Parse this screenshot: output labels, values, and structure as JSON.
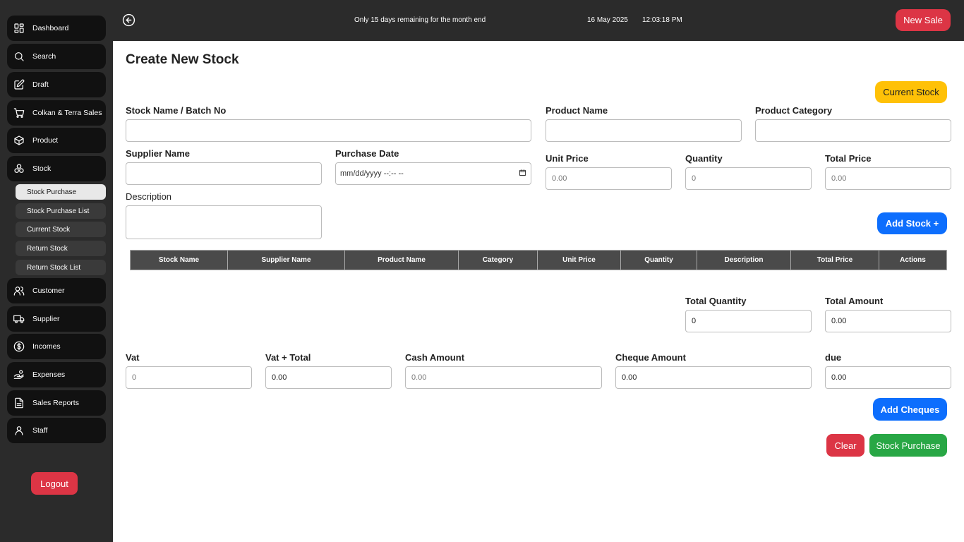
{
  "sidebar": {
    "items": [
      {
        "label": "Dashboard",
        "icon": "dashboard-icon"
      },
      {
        "label": "Search",
        "icon": "search-icon"
      },
      {
        "label": "Draft",
        "icon": "edit-icon"
      },
      {
        "label": "Colkan & Terra Sales",
        "icon": "cart-icon"
      },
      {
        "label": "Product",
        "icon": "box-icon"
      },
      {
        "label": "Stock",
        "icon": "stock-icon"
      },
      {
        "label": "Customer",
        "icon": "users-icon"
      },
      {
        "label": "Supplier",
        "icon": "truck-icon"
      },
      {
        "label": "Incomes",
        "icon": "dollar-icon"
      },
      {
        "label": "Expenses",
        "icon": "hand-coin-icon"
      },
      {
        "label": "Sales Reports",
        "icon": "report-icon"
      },
      {
        "label": "Staff",
        "icon": "user-icon"
      }
    ],
    "stock_subitems": [
      {
        "label": "Stock Purchase",
        "active": true
      },
      {
        "label": "Stock Purchase List"
      },
      {
        "label": "Current Stock"
      },
      {
        "label": "Return Stock"
      },
      {
        "label": "Return Stock List"
      }
    ],
    "logout_label": "Logout"
  },
  "topbar": {
    "notice": "Only 15 days remaining for the month end",
    "date": "16 May 2025",
    "time": "12:03:18 PM",
    "new_sale_label": "New Sale"
  },
  "page": {
    "title": "Create New Stock",
    "current_stock_label": "Current Stock"
  },
  "form": {
    "stock_name_label": "Stock Name / Batch No",
    "product_name_label": "Product Name",
    "product_category_label": "Product Category",
    "supplier_name_label": "Supplier Name",
    "purchase_date_label": "Purchase Date",
    "purchase_date_placeholder": "mm/dd/yyyy --:-- --",
    "unit_price_label": "Unit Price",
    "unit_price_placeholder": "0.00",
    "quantity_label": "Quantity",
    "quantity_placeholder": "0",
    "total_price_label": "Total Price",
    "total_price_placeholder": "0.00",
    "description_label": "Description",
    "add_stock_label": "Add Stock +"
  },
  "table": {
    "columns": [
      "Stock Name",
      "Supplier Name",
      "Product Name",
      "Category",
      "Unit Price",
      "Quantity",
      "Description",
      "Total Price",
      "Actions"
    ]
  },
  "totals": {
    "total_quantity_label": "Total Quantity",
    "total_quantity_value": "0",
    "total_amount_label": "Total Amount",
    "total_amount_value": "0.00"
  },
  "payment": {
    "vat_label": "Vat",
    "vat_placeholder": "0",
    "vat_total_label": "Vat + Total",
    "vat_total_value": "0.00",
    "cash_label": "Cash Amount",
    "cash_placeholder": "0.00",
    "cheque_label": "Cheque Amount",
    "cheque_value": "0.00",
    "due_label": "due",
    "due_value": "0.00",
    "add_cheques_label": "Add Cheques",
    "clear_label": "Clear",
    "stock_purchase_label": "Stock Purchase"
  }
}
